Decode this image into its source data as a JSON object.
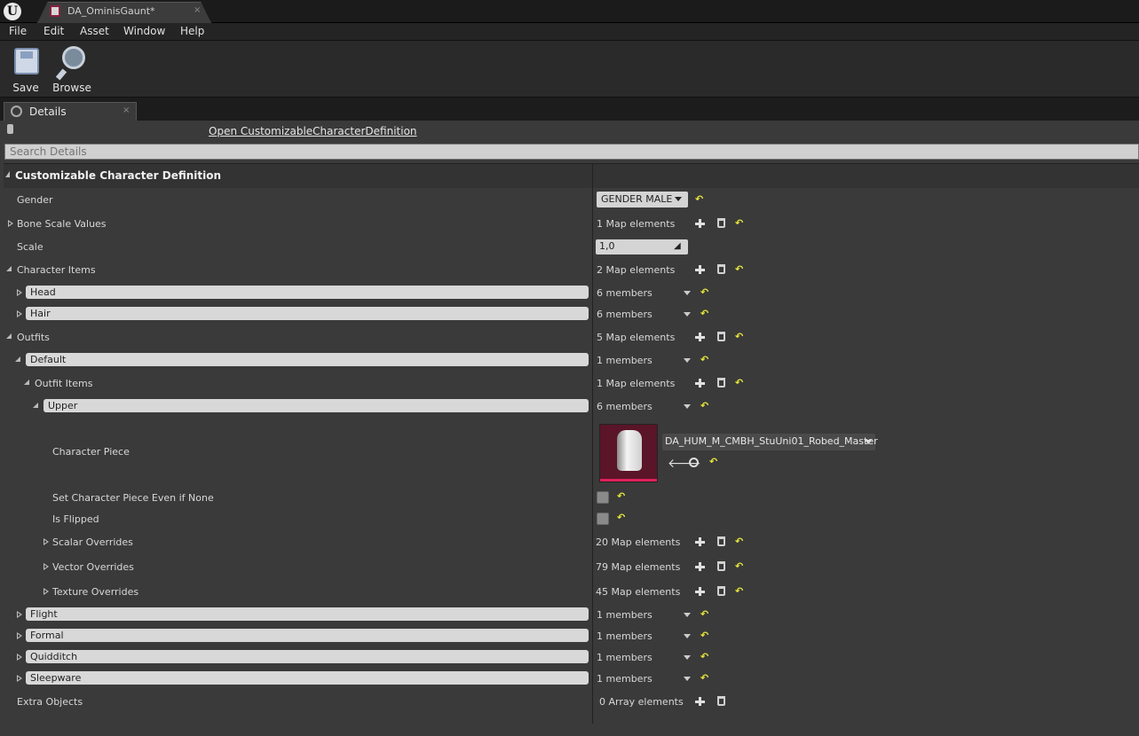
{
  "window": {
    "logo": "U",
    "tab_title": "DA_OminisGaunt*",
    "tab_close": "×"
  },
  "menu": {
    "items": [
      "File",
      "Edit",
      "Asset",
      "Window",
      "Help"
    ]
  },
  "toolbar": {
    "save_label": "Save",
    "browse_label": "Browse"
  },
  "details": {
    "tab_label": "Details",
    "tab_close": "×",
    "open_link": "Open CustomizableCharacterDefinition",
    "search_placeholder": "Search Details",
    "category": "Customizable Character Definition"
  },
  "props": {
    "gender": {
      "label": "Gender",
      "value": "GENDER MALE"
    },
    "bone_scale": {
      "label": "Bone Scale Values",
      "value": "1 Map elements"
    },
    "scale": {
      "label": "Scale",
      "value": "1,0"
    },
    "character_items": {
      "label": "Character Items",
      "value": "2 Map elements"
    },
    "head": {
      "key": "Head",
      "value": "6 members"
    },
    "hair": {
      "key": "Hair",
      "value": "6 members"
    },
    "outfits": {
      "label": "Outfits",
      "value": "5 Map elements"
    },
    "default": {
      "key": "Default",
      "value": "1 members"
    },
    "outfit_items": {
      "label": "Outfit Items",
      "value": "1 Map elements"
    },
    "upper": {
      "key": "Upper",
      "value": "6 members"
    },
    "character_piece": {
      "label": "Character Piece",
      "value": "DA_HUM_M_CMBH_StuUni01_Robed_Master"
    },
    "set_piece_none": {
      "label": "Set Character Piece Even if None"
    },
    "is_flipped": {
      "label": "Is Flipped"
    },
    "scalar_overrides": {
      "label": "Scalar Overrides",
      "value": "20 Map elements"
    },
    "vector_overrides": {
      "label": "Vector Overrides",
      "value": "79 Map elements"
    },
    "texture_overrides": {
      "label": "Texture Overrides",
      "value": "45 Map elements"
    },
    "flight": {
      "key": "Flight",
      "value": "1 members"
    },
    "formal": {
      "key": "Formal",
      "value": "1 members"
    },
    "quidditch": {
      "key": "Quidditch",
      "value": "1 members"
    },
    "sleepware": {
      "key": "Sleepware",
      "value": "1 members"
    },
    "extra_objects": {
      "label": "Extra Objects",
      "value": "0 Array elements"
    }
  },
  "colors": {
    "accent_reset": "#e8e63a",
    "thumb_bg": "#5a1528",
    "thumb_bar": "#e0205a"
  }
}
